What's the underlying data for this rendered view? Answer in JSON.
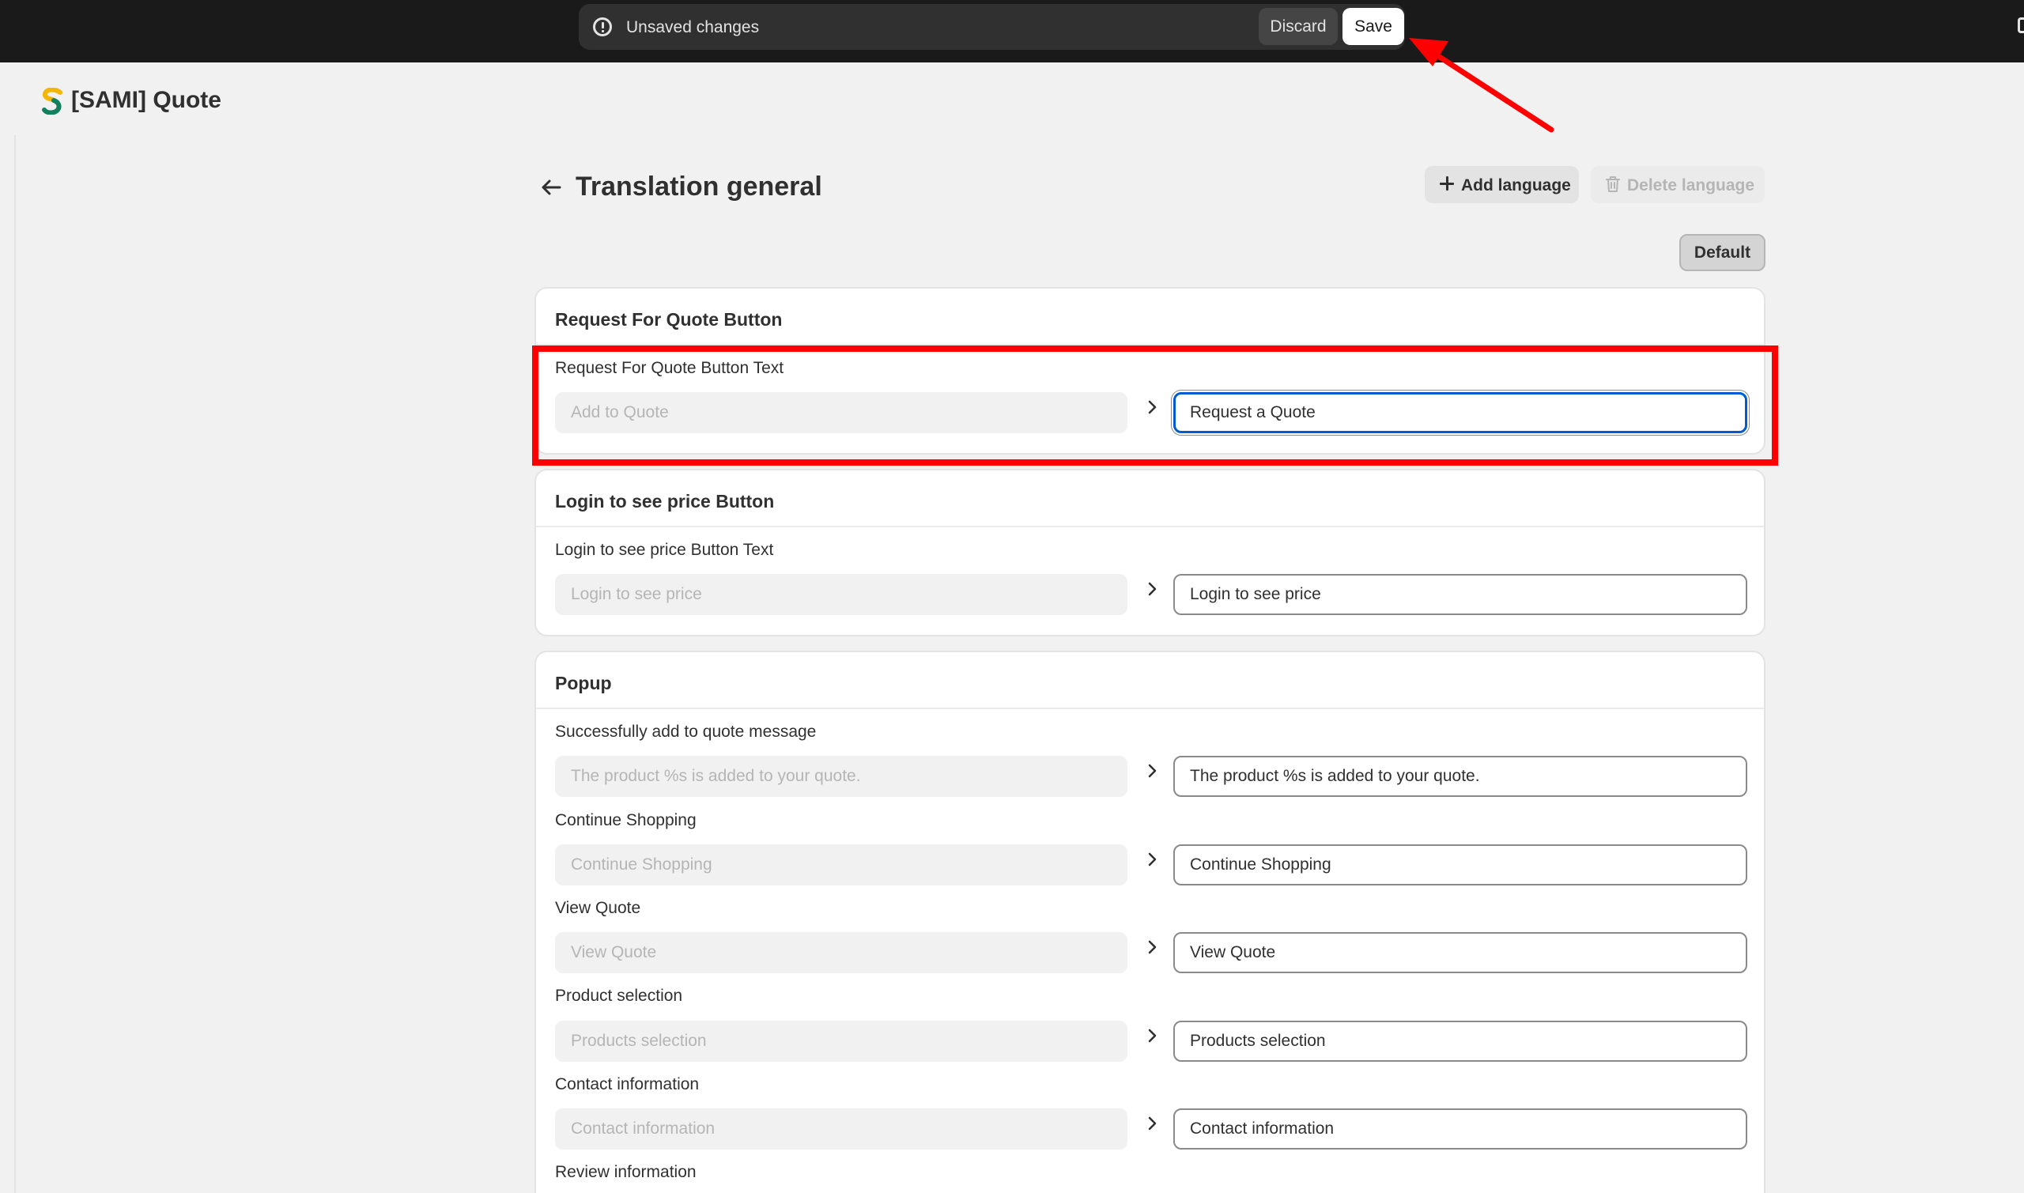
{
  "savebar": {
    "message": "Unsaved changes",
    "discard_label": "Discard",
    "save_label": "Save"
  },
  "app": {
    "title": "[SAMI] Quote"
  },
  "page": {
    "title": "Translation general",
    "add_language_label": "Add language",
    "delete_language_label": "Delete language",
    "default_label": "Default"
  },
  "sections": [
    {
      "title": "Request For Quote Button",
      "fields": [
        {
          "label": "Request For Quote Button Text",
          "source": "Add to Quote",
          "value": "Request a Quote"
        }
      ]
    },
    {
      "title": "Login to see price Button",
      "fields": [
        {
          "label": "Login to see price Button Text",
          "source": "Login to see price",
          "value": "Login to see price"
        }
      ]
    },
    {
      "title": "Popup",
      "fields": [
        {
          "label": "Successfully add to quote message",
          "source": "The product %s is added to your quote.",
          "value": "The product %s is added to your quote."
        },
        {
          "label": "Continue Shopping",
          "source": "Continue Shopping",
          "value": "Continue Shopping"
        },
        {
          "label": "View Quote",
          "source": "View Quote",
          "value": "View Quote"
        },
        {
          "label": "Product selection",
          "source": "Products selection",
          "value": "Products selection"
        },
        {
          "label": "Contact information",
          "source": "Contact information",
          "value": "Contact information"
        },
        {
          "label": "Review information",
          "source": "",
          "value": ""
        }
      ]
    }
  ],
  "icons": {
    "unsaved": "alert-circle-icon",
    "back": "arrow-left-icon",
    "add": "plus-icon",
    "delete": "trash-icon",
    "separator": "chevron-right-icon",
    "logo": "sami-logo"
  },
  "colors": {
    "topbar": "#1a1a1a",
    "focus": "#005bd3",
    "annotation": "#ff0000"
  }
}
